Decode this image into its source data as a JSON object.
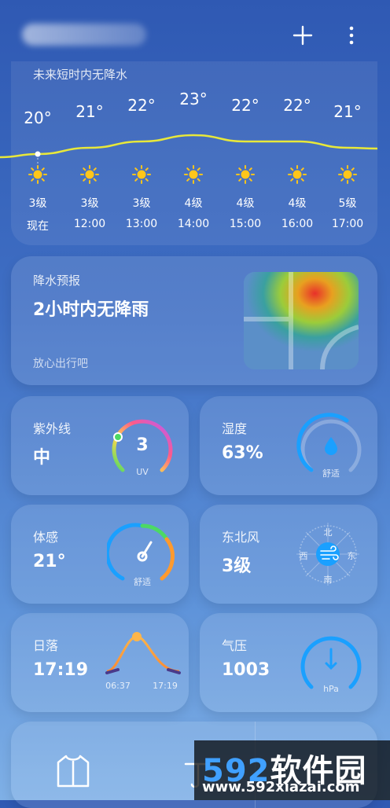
{
  "header": {
    "add_icon": "plus-icon",
    "more_icon": "more-vertical-icon"
  },
  "hourly": {
    "title": "未来短时内无降水",
    "points": [
      {
        "temp": "20°",
        "wind": "3级",
        "time": "现在",
        "t": 20
      },
      {
        "temp": "21°",
        "wind": "3级",
        "time": "12:00",
        "t": 21
      },
      {
        "temp": "22°",
        "wind": "3级",
        "time": "13:00",
        "t": 22
      },
      {
        "temp": "23°",
        "wind": "4级",
        "time": "14:00",
        "t": 23
      },
      {
        "temp": "22°",
        "wind": "4级",
        "time": "15:00",
        "t": 22
      },
      {
        "temp": "22°",
        "wind": "4级",
        "time": "16:00",
        "t": 22
      },
      {
        "temp": "21°",
        "wind": "5级",
        "time": "17:00",
        "t": 21
      }
    ],
    "line_color": "#e8e83a"
  },
  "precip": {
    "title": "降水预报",
    "main": "2小时内无降雨",
    "sub": "放心出行吧"
  },
  "uv": {
    "label": "紫外线",
    "value": "中",
    "index": "3",
    "unit": "UV"
  },
  "humidity": {
    "label": "湿度",
    "value": "63%",
    "status": "舒适",
    "percent": 63
  },
  "feels": {
    "label": "体感",
    "value": "21°",
    "status": "舒适"
  },
  "wind": {
    "label": "东北风",
    "value": "3级",
    "north": "北",
    "south": "南",
    "east": "东",
    "west": "西"
  },
  "sunset": {
    "label": "日落",
    "value": "17:19",
    "sunrise_time": "06:37",
    "sunset_time": "17:19"
  },
  "pressure": {
    "label": "气压",
    "value": "1003",
    "unit": "hPa"
  },
  "bottom": {
    "icons": [
      "jacket-icon",
      "umbrella-icon"
    ]
  },
  "watermark": {
    "num": "592",
    "text": "软件园",
    "url": "www.592xiazai.com"
  }
}
